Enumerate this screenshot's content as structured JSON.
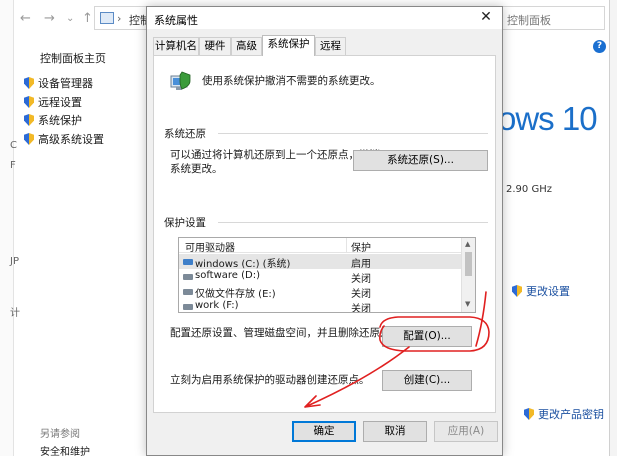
{
  "background": {
    "address_text": "控制",
    "search_placeholder": "控制面板",
    "help": "?",
    "sidebar_home": "控制面板主页",
    "sidebar_items": [
      {
        "label": "设备管理器"
      },
      {
        "label": "远程设置"
      },
      {
        "label": "系统保护"
      },
      {
        "label": "高级系统设置"
      }
    ],
    "logo_text": "ows 10",
    "cpu_speed": "2.90 GHz",
    "change_settings": "更改设置",
    "change_key": "更改产品密钥",
    "see_also": "另请参阅",
    "security_maintenance": "安全和维护",
    "edge_letters": [
      "C",
      "F",
      "JP",
      "计"
    ]
  },
  "dialog": {
    "title": "系统属性",
    "close": "✕",
    "tabs": [
      {
        "label": "计算机名"
      },
      {
        "label": "硬件"
      },
      {
        "label": "高级"
      },
      {
        "label": "系统保护",
        "active": true
      },
      {
        "label": "远程"
      }
    ],
    "top_description": "使用系统保护撤消不需要的系统更改。",
    "restore_group": "系统还原",
    "restore_text": [
      "可以通过将计算机还原到上一个还原点，撤消",
      "系统更改。"
    ],
    "restore_button": "系统还原(S)...",
    "protection_group": "保护设置",
    "drives_header": {
      "name": "可用驱动器",
      "protection": "保护"
    },
    "drives": [
      {
        "name": "windows (C:) (系统)",
        "protection": "启用",
        "icon": "windows-drive-icon",
        "selected": true
      },
      {
        "name": "software (D:)",
        "protection": "关闭",
        "icon": "drive-icon"
      },
      {
        "name": "仅做文件存放 (E:)",
        "protection": "关闭",
        "icon": "drive-icon"
      },
      {
        "name": "work (F:)",
        "protection": "关闭",
        "icon": "drive-icon"
      }
    ],
    "configure_text": "配置还原设置、管理磁盘空间，并且删除还原点。",
    "configure_button": "配置(O)...",
    "create_text": "立刻为启用系统保护的驱动器创建还原点。",
    "create_button": "创建(C)...",
    "ok_button": "确定",
    "cancel_button": "取消",
    "apply_button": "应用(A)"
  },
  "colors": {
    "annotation": "#e02020",
    "accent": "#0078d7",
    "logo": "#1b6fc9"
  }
}
